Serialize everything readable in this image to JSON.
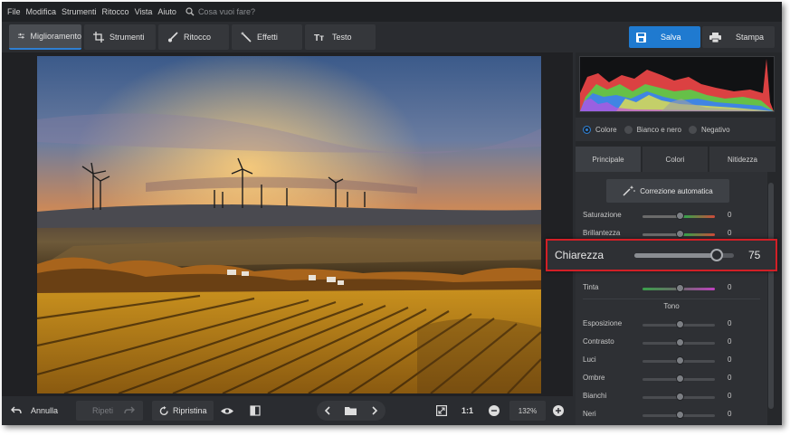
{
  "menu": [
    "File",
    "Modifica",
    "Strumenti",
    "Ritocco",
    "Vista",
    "Aiuto"
  ],
  "search": {
    "placeholder": "Cosa vuoi fare?",
    "icon": "search-icon"
  },
  "tabs": [
    {
      "label": "Miglioramento",
      "icon": "sliders-icon",
      "active": true
    },
    {
      "label": "Strumenti",
      "icon": "crop-icon"
    },
    {
      "label": "Ritocco",
      "icon": "brush-icon"
    },
    {
      "label": "Effetti",
      "icon": "magic-wand-icon"
    },
    {
      "label": "Testo",
      "icon": "text-icon"
    }
  ],
  "actions": {
    "save_label": "Salva",
    "print_label": "Stampa"
  },
  "bottom": {
    "undo_label": "Annulla",
    "redo_label": "Ripeti",
    "reset_label": "Ripristina",
    "ratio_label": "1:1",
    "zoom_value": "132%"
  },
  "color_modes": [
    {
      "label": "Colore",
      "selected": true
    },
    {
      "label": "Bianco e nero",
      "selected": false
    },
    {
      "label": "Negativo",
      "selected": false
    }
  ],
  "subtabs": [
    {
      "label": "Principale",
      "active": true
    },
    {
      "label": "Colori"
    },
    {
      "label": "Nitidezza"
    }
  ],
  "auto_correct_label": "Correzione automatica",
  "sliders_color": [
    {
      "label": "Saturazione",
      "value": "0"
    },
    {
      "label": "Brillantezza",
      "value": "0"
    },
    {
      "label": "Tinta",
      "value": "0"
    }
  ],
  "section_tone": "Tono",
  "sliders_tone": [
    {
      "label": "Esposizione",
      "value": "0"
    },
    {
      "label": "Contrasto",
      "value": "0"
    },
    {
      "label": "Luci",
      "value": "0"
    },
    {
      "label": "Ombre",
      "value": "0"
    },
    {
      "label": "Bianchi",
      "value": "0"
    },
    {
      "label": "Neri",
      "value": "0"
    }
  ],
  "highlight": {
    "label": "Chiarezza",
    "value": "75",
    "level": 0.75
  },
  "colors": {
    "accent": "#1f7ad0",
    "highlight_border": "#d21f26",
    "bg": "#2a2c30"
  }
}
